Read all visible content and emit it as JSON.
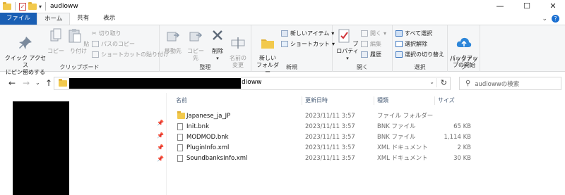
{
  "window": {
    "title": "audioww"
  },
  "tabs": [
    {
      "label": "ファイル"
    },
    {
      "label": "ホーム"
    },
    {
      "label": "共有"
    },
    {
      "label": "表示"
    }
  ],
  "ribbon": {
    "clipboard": {
      "group_label": "クリップボード",
      "quick_access": "クイック アクセス\nにピン留めする",
      "copy": "コピー",
      "paste": "貼り付け",
      "cut": "切り取り",
      "copy_path": "パスのコピー",
      "paste_shortcut": "ショートカットの貼り付け"
    },
    "organize": {
      "group_label": "整理",
      "move_to": "移動先",
      "copy_to": "コピー先",
      "delete": "削除",
      "rename": "名前の\n変更"
    },
    "new": {
      "group_label": "新規",
      "new_folder": "新しい\nフォルダー",
      "new_item": "新しいアイテム",
      "shortcut": "ショートカット"
    },
    "open": {
      "group_label": "開く",
      "properties": "プロパティ",
      "open": "開く",
      "edit": "編集",
      "history": "履歴"
    },
    "select": {
      "group_label": "選択",
      "select_all": "すべて選択",
      "select_none": "選択解除",
      "invert": "選択の切り替え"
    },
    "backup": {
      "group_label": "バックアップ",
      "start_backup": "バックアッ\nプの開始"
    }
  },
  "address": {
    "path_tail": "dioww",
    "search_placeholder": "audiowwの検索"
  },
  "columns": {
    "name": "名前",
    "date": "更新日時",
    "type": "種類",
    "size": "サイズ"
  },
  "files": [
    {
      "name": "Japanese_ja_JP",
      "date": "2023/11/11 3:57",
      "type": "ファイル フォルダー",
      "size": "",
      "kind": "folder"
    },
    {
      "name": "Init.bnk",
      "date": "2023/11/11 3:57",
      "type": "BNK ファイル",
      "size": "65 KB",
      "kind": "file"
    },
    {
      "name": "MODMOD.bnk",
      "date": "2023/11/11 3:57",
      "type": "BNK ファイル",
      "size": "1,114 KB",
      "kind": "file"
    },
    {
      "name": "PluginInfo.xml",
      "date": "2023/11/11 3:57",
      "type": "XML ドキュメント",
      "size": "2 KB",
      "kind": "file"
    },
    {
      "name": "SoundbanksInfo.xml",
      "date": "2023/11/11 3:57",
      "type": "XML ドキュメント",
      "size": "30 KB",
      "kind": "file"
    }
  ],
  "colors": {
    "accent": "#1a5fb4",
    "folder": "#f2c94c"
  }
}
